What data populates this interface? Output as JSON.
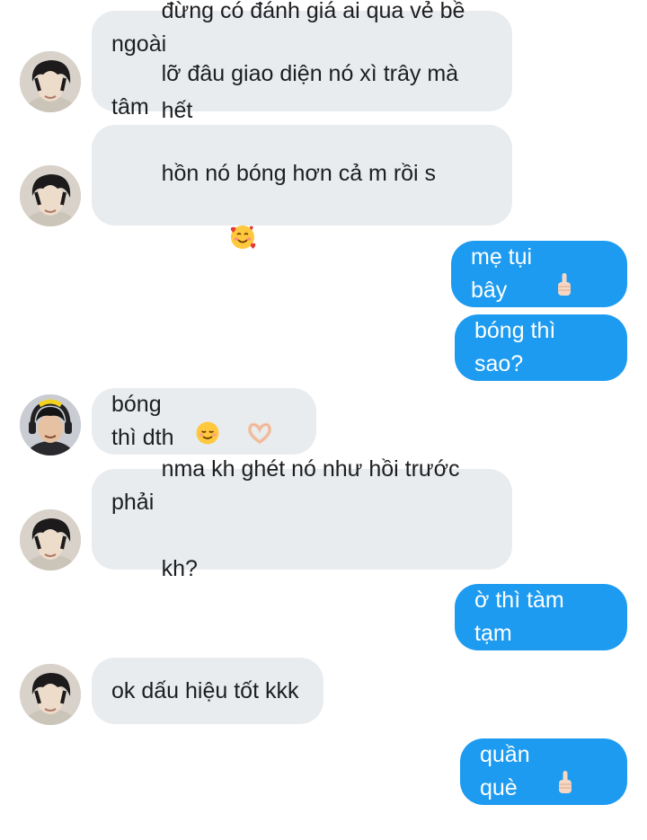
{
  "conversation": {
    "messages": [
      {
        "id": "m1",
        "direction": "incoming",
        "sender": "friend-a",
        "text_line1": "đừng có đánh giá ai qua vẻ bề ngoài",
        "text_line2": "hết"
      },
      {
        "id": "m2",
        "direction": "incoming",
        "sender": "friend-a",
        "text_line1": "lỡ đâu giao diện nó xì trây mà tâm",
        "text_line2": "hồn nó bóng hơn cả m rồi s",
        "emoji": "smiling-face-with-hearts"
      },
      {
        "id": "m3",
        "direction": "outgoing",
        "text": "mẹ tụi bây",
        "emoji": "middle-finger"
      },
      {
        "id": "m4",
        "direction": "outgoing",
        "text": "bóng thì sao?"
      },
      {
        "id": "m5",
        "direction": "incoming",
        "sender": "friend-b",
        "text": "bóng thì dth",
        "emoji": "smiling-face + heart-hands"
      },
      {
        "id": "m6",
        "direction": "incoming",
        "sender": "friend-a",
        "text_line1": "nma kh ghét nó như hồi trước phải",
        "text_line2": "kh?"
      },
      {
        "id": "m7",
        "direction": "outgoing",
        "text": "ờ thì tàm tạm"
      },
      {
        "id": "m8",
        "direction": "incoming",
        "sender": "friend-a",
        "text": "ok dấu hiệu tốt kkk"
      },
      {
        "id": "m9",
        "direction": "outgoing",
        "text": "quần què",
        "emoji": "middle-finger"
      }
    ]
  },
  "colors": {
    "incoming_bubble": "#e9ecef",
    "outgoing_bubble": "#1d9bf0",
    "incoming_text": "#1c1e21",
    "outgoing_text": "#ffffff"
  }
}
